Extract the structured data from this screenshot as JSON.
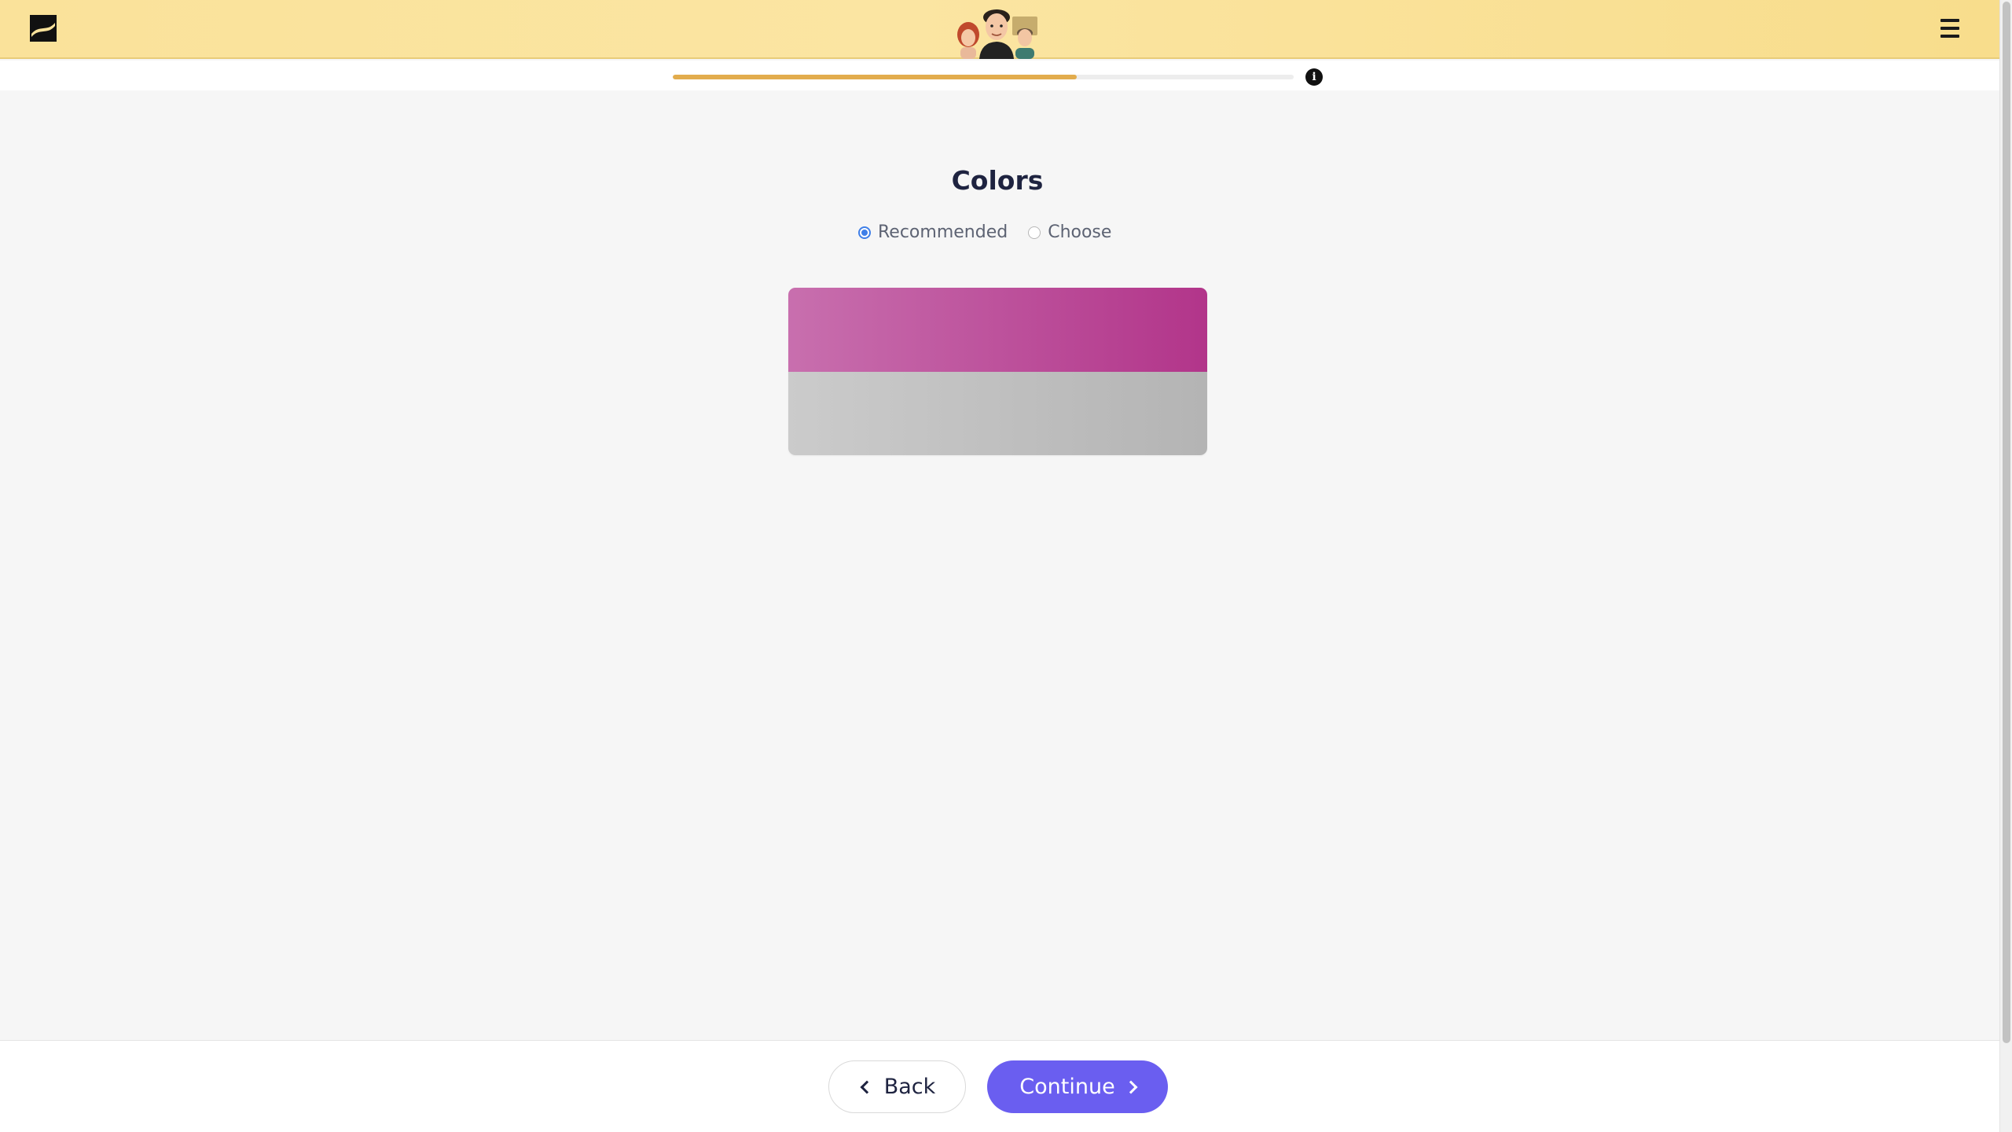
{
  "header": {
    "logo_icon": "stripe-slash-logo-icon",
    "mascot_icon": "three-people-avatar-icon",
    "menu_icon": "hamburger-menu-icon"
  },
  "progress": {
    "value": 0.65,
    "info_icon": "info-icon",
    "info_glyph": "i"
  },
  "main": {
    "title": "Colors",
    "options": [
      {
        "label": "Recommended",
        "selected": true
      },
      {
        "label": "Choose",
        "selected": false
      }
    ],
    "swatch": {
      "primary_from": "#c86fae",
      "primary_to": "#b2358a",
      "secondary_from": "#cbcbcb",
      "secondary_to": "#b4b4b4"
    }
  },
  "footer": {
    "back_label": "Back",
    "continue_label": "Continue",
    "continue_color": "#6a5ef0"
  }
}
